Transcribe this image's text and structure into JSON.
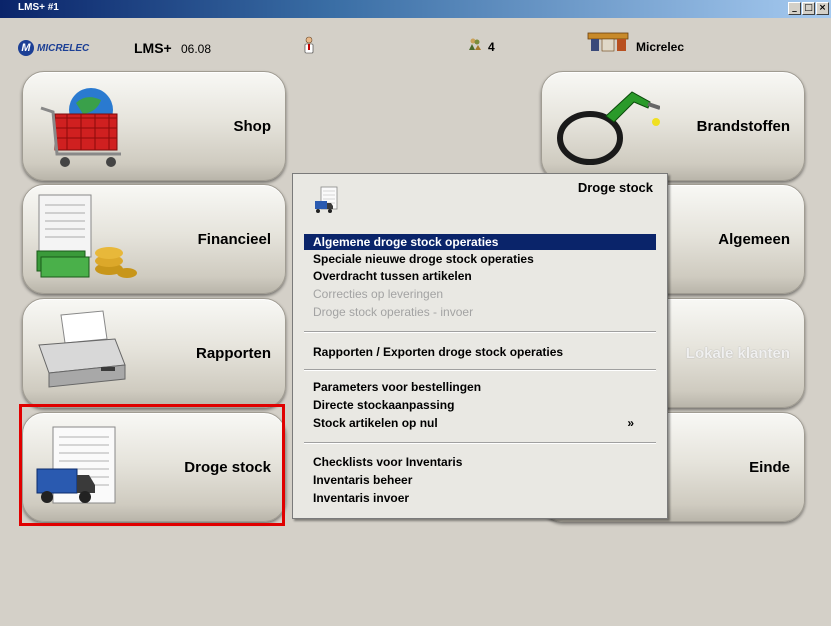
{
  "window": {
    "title": "LMS+ #1",
    "controls": {
      "minimize": "_",
      "restore": "&#x25A1;",
      "close": "×"
    }
  },
  "header": {
    "logo_text": "MICRELEC",
    "logo_mark": "M",
    "app_name": "LMS+",
    "version": "06.08",
    "count": "4",
    "station": "Micrelec"
  },
  "tiles": {
    "shop": "Shop",
    "brandstoffen": "Brandstoffen",
    "financieel": "Financieel",
    "algemeen": "Algemeen",
    "rapporten": "Rapporten",
    "lokale_klanten": "Lokale klanten",
    "droge_stock": "Droge stock",
    "einde": "Einde"
  },
  "popup": {
    "title": "Droge stock",
    "items": [
      {
        "label": "Algemene droge stock operaties",
        "state": "selected"
      },
      {
        "label": "Speciale nieuwe droge stock operaties",
        "state": "enabled"
      },
      {
        "label": "Overdracht tussen artikelen",
        "state": "enabled"
      },
      {
        "label": "Correcties op leveringen",
        "state": "disabled"
      },
      {
        "label": "Droge stock operaties - invoer",
        "state": "disabled"
      },
      {
        "label": "Rapporten / Exporten droge stock operaties",
        "state": "enabled"
      },
      {
        "label": "Parameters voor bestellingen",
        "state": "enabled"
      },
      {
        "label": "Directe stockaanpassing",
        "state": "enabled"
      },
      {
        "label": "Stock artikelen op nul",
        "state": "enabled",
        "submenu": "»"
      },
      {
        "label": "Checklists voor Inventaris",
        "state": "enabled"
      },
      {
        "label": "Inventaris beheer",
        "state": "enabled"
      },
      {
        "label": "Inventaris invoer",
        "state": "enabled"
      }
    ]
  },
  "colors": {
    "selection": "#0a246a",
    "highlight_box": "#e00000",
    "background": "#d4d0c8"
  }
}
